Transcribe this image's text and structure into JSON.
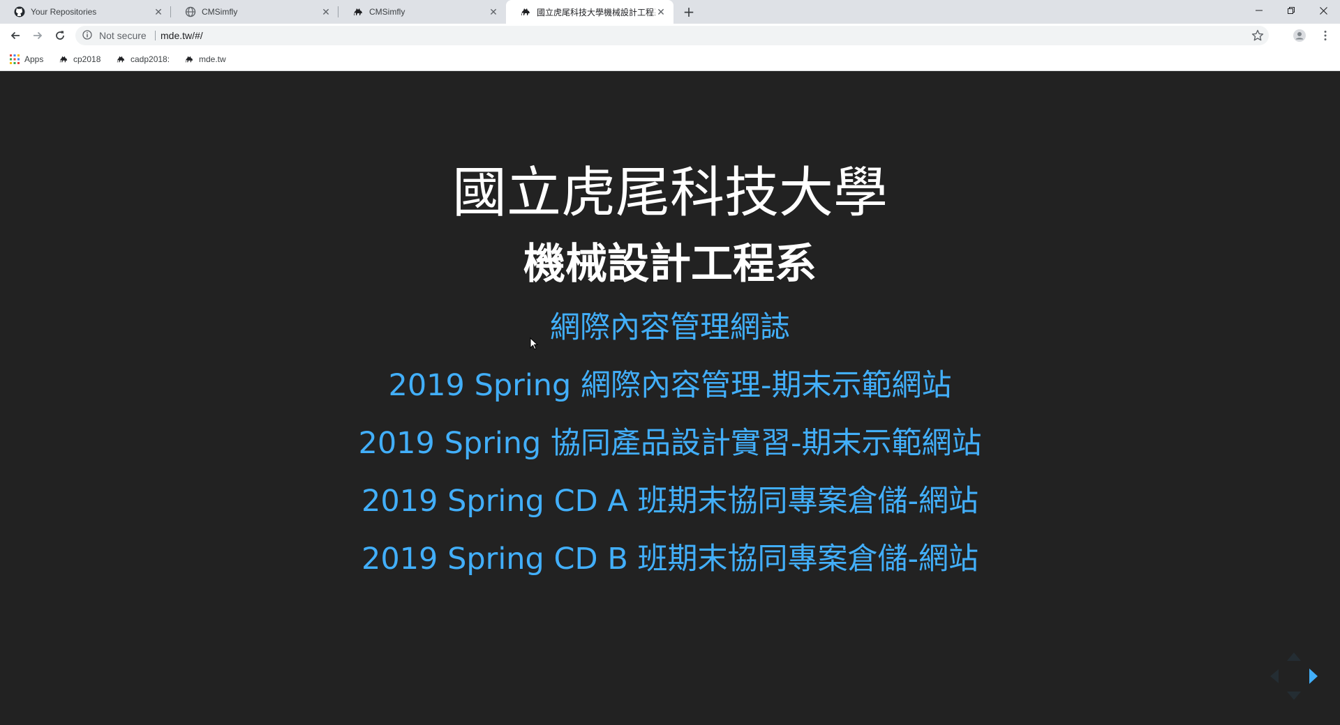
{
  "browser": {
    "tabs": [
      {
        "title": "Your Repositories",
        "icon": "github-icon",
        "active": false
      },
      {
        "title": "CMSimfly",
        "icon": "globe-icon",
        "active": false
      },
      {
        "title": "CMSimfly",
        "icon": "camel-icon",
        "active": false
      },
      {
        "title": "國立虎尾科技大學機械設計工程系",
        "icon": "camel-icon",
        "active": true
      }
    ],
    "new_tab_label": "+",
    "window_controls": {
      "minimize": "—",
      "restore": "❐",
      "close": "✕"
    },
    "address": {
      "security_label": "Not secure",
      "url": "mde.tw/#/"
    },
    "bookmarks": [
      {
        "label": "Apps",
        "icon": "apps-grid-icon"
      },
      {
        "label": "cp2018",
        "icon": "camel-icon"
      },
      {
        "label": "cadp2018:",
        "icon": "camel-icon"
      },
      {
        "label": "mde.tw",
        "icon": "camel-icon"
      }
    ]
  },
  "page": {
    "title": "國立虎尾科技大學",
    "subtitle": "機械設計工程系",
    "links": [
      "網際內容管理網誌",
      "2019 Spring 網際內容管理-期末示範網站",
      "2019 Spring 協同產品設計實習-期末示範網站",
      "2019 Spring CD A 班期末協同專案倉儲-網站",
      "2019 Spring CD B 班期末協同專案倉儲-網站"
    ]
  },
  "colors": {
    "background": "#222222",
    "heading": "#ffffff",
    "link": "#42affa",
    "tabstrip": "#dee1e6"
  }
}
